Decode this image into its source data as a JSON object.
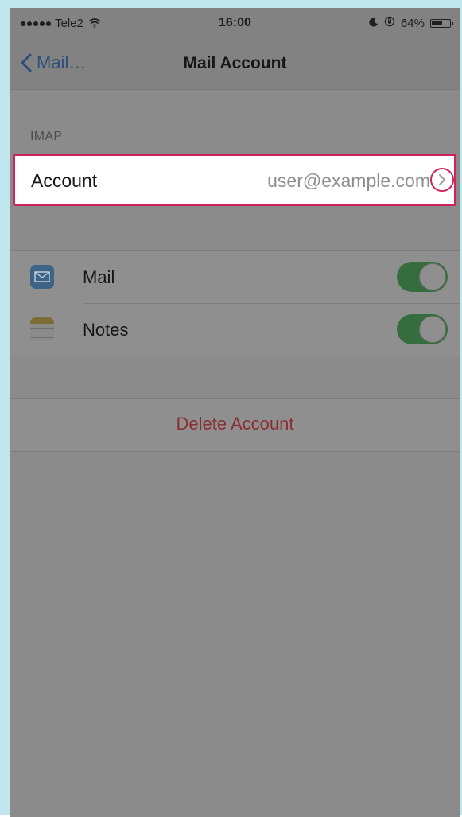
{
  "status_bar": {
    "carrier": "Tele2",
    "time": "16:00",
    "battery": "64%",
    "battery_level": 0.64
  },
  "nav": {
    "back_label": "Mail…",
    "title": "Mail Account"
  },
  "section": {
    "label": "IMAP"
  },
  "account_row": {
    "label": "Account",
    "value": "user@example.com"
  },
  "toggles": [
    {
      "label": "Mail",
      "on": true
    },
    {
      "label": "Notes",
      "on": true
    }
  ],
  "delete": {
    "label": "Delete Account"
  },
  "colors": {
    "highlight": "#d0225e",
    "toggle_on": "#356d3e",
    "destructive": "#8a2f31",
    "link": "#2b4f7a"
  }
}
